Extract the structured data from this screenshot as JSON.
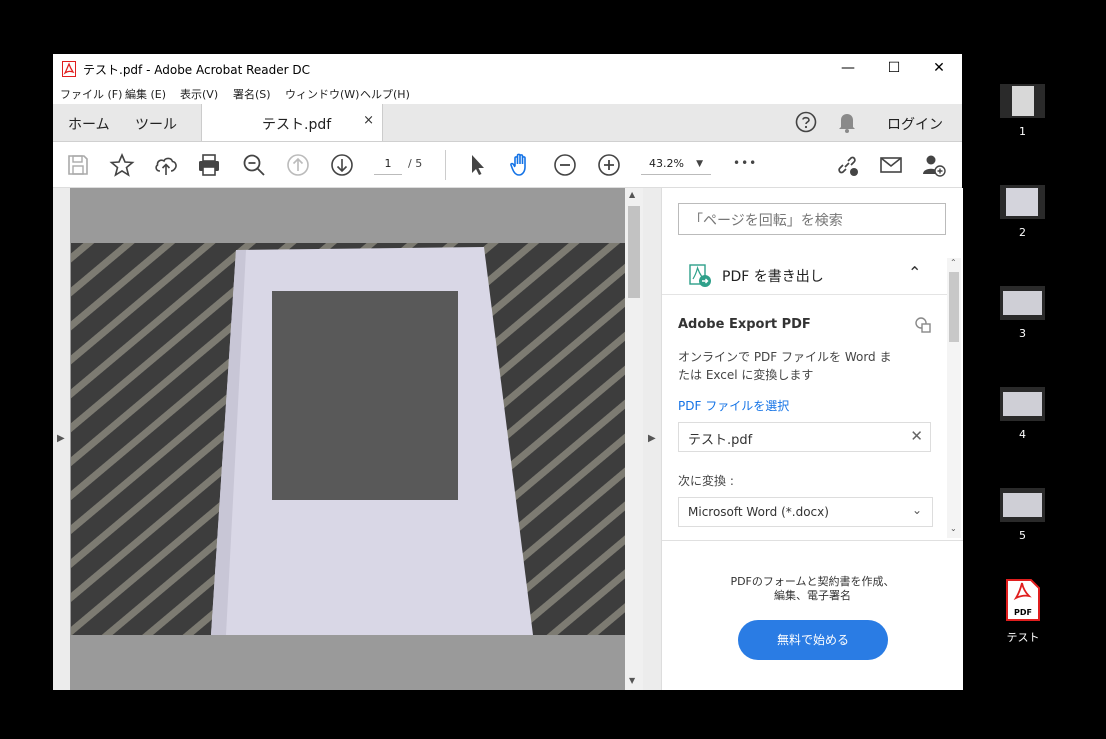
{
  "window": {
    "title": "テスト.pdf - Adobe Acrobat Reader DC",
    "controls": {
      "minimize": "—",
      "maximize": "☐",
      "close": "✕"
    }
  },
  "menubar": [
    "ファイル (F)",
    "編集 (E)",
    "表示(V)",
    "署名(S)",
    "ウィンドウ(W)",
    "ヘルプ(H)"
  ],
  "tabs": {
    "home": "ホーム",
    "tools": "ツール",
    "document": "テスト.pdf",
    "close": "×",
    "login": "ログイン"
  },
  "toolbar": {
    "current_page": "1",
    "total_pages": "/ 5",
    "zoom": "43.2%",
    "more": "•••"
  },
  "right_panel": {
    "search_placeholder": "「ページを回転」を検索",
    "export_header": "PDF を書き出し",
    "export_title": "Adobe Export PDF",
    "export_desc_line1": "オンラインで PDF ファイルを Word ま",
    "export_desc_line2": "たは Excel に変換します",
    "select_link": "PDF ファイルを選択",
    "selected_file": "テスト.pdf",
    "convert_label": "次に変換 :",
    "convert_option": "Microsoft Word (*.docx)",
    "promo_line1": "PDFのフォームと契約書を作成、",
    "promo_line2": "編集、電子署名",
    "start_button": "無料で始める"
  },
  "desktop": {
    "thumbnails": [
      "1",
      "2",
      "3",
      "4",
      "5"
    ],
    "file_icon_label": "PDF",
    "file_name": "テスト"
  },
  "colors": {
    "accent": "#2a7ce4",
    "acrobat_red": "#e01e1e",
    "link": "#1473e6"
  }
}
